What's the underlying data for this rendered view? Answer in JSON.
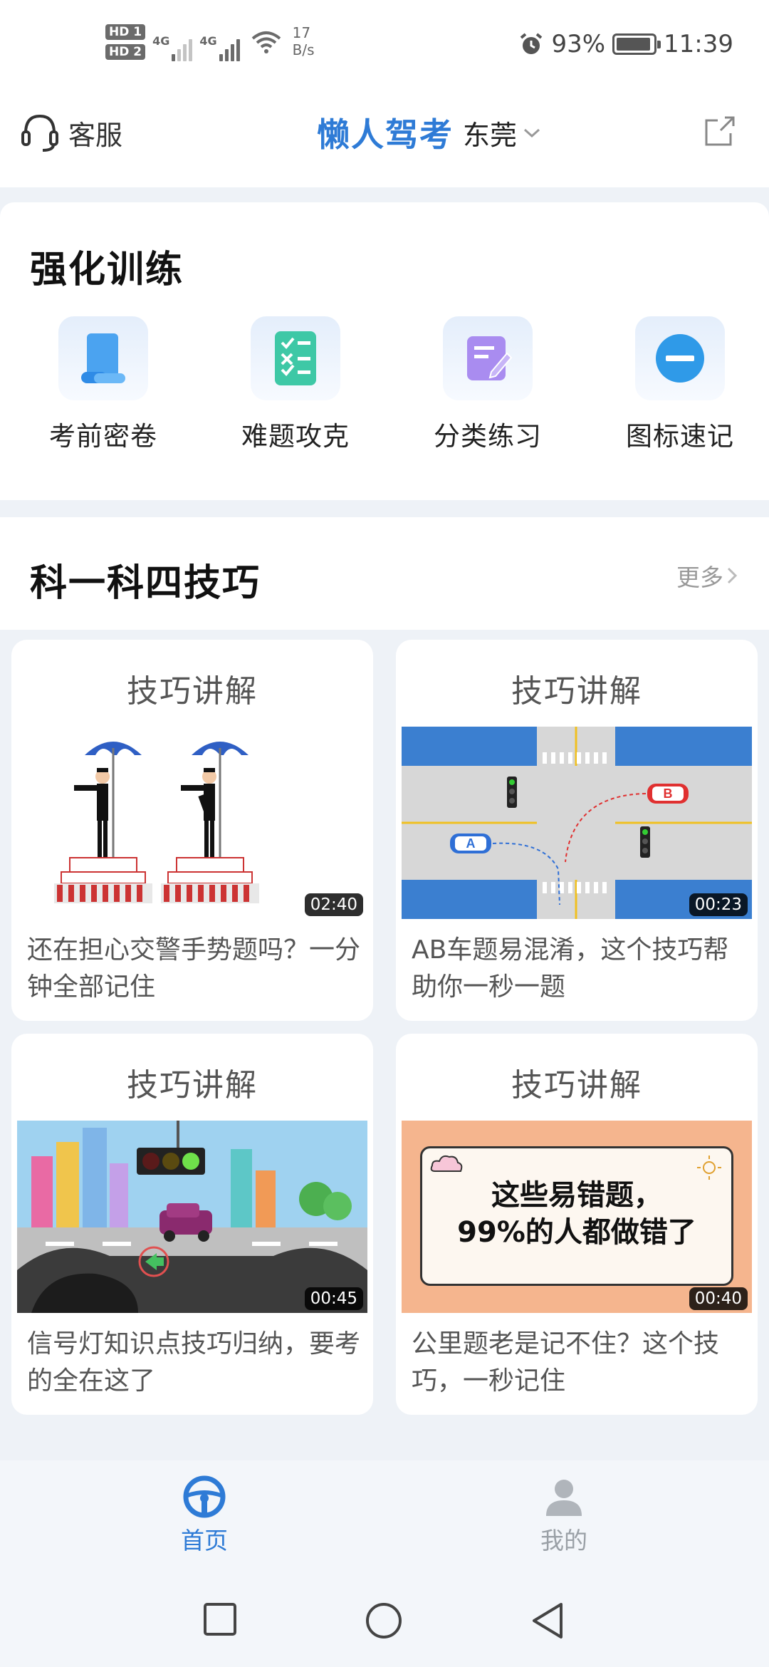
{
  "status_bar": {
    "hd1": "HD 1",
    "hd2": "HD 2",
    "sim1_label": "4G",
    "sim2_label": "4G",
    "net_speed_value": "17",
    "net_speed_unit": "B/s",
    "battery_percent": "93%",
    "battery_level": 0.93,
    "time": "11:39"
  },
  "header": {
    "service_label": "客服",
    "app_title": "懒人驾考",
    "city": "东莞"
  },
  "training": {
    "title": "强化训练",
    "items": [
      {
        "label": "考前密卷",
        "icon": "scroll-icon"
      },
      {
        "label": "难题攻克",
        "icon": "checklist-icon"
      },
      {
        "label": "分类练习",
        "icon": "edit-note-icon"
      },
      {
        "label": "图标速记",
        "icon": "no-entry-sign-icon"
      }
    ]
  },
  "tips": {
    "title": "科一科四技巧",
    "more_label": "更多",
    "videos": [
      {
        "tag": "技巧讲解",
        "duration": "02:40",
        "desc": "还在担心交警手势题吗？一分钟全部记住",
        "thumb": "traffic-police-gesture"
      },
      {
        "tag": "技巧讲解",
        "duration": "00:23",
        "desc": "AB车题易混淆，这个技巧帮助你一秒一题",
        "thumb": "intersection-ab-cars"
      },
      {
        "tag": "技巧讲解",
        "duration": "00:45",
        "desc": "信号灯知识点技巧归纳，要考的全在这了",
        "thumb": "traffic-light-dashboard"
      },
      {
        "tag": "技巧讲解",
        "duration": "00:40",
        "desc": "公里题老是记不住？这个技巧，一秒记住",
        "thumb": "mistake-poster"
      }
    ],
    "poster_line1": "这些易错题，",
    "poster_line2": "99%的人都做错了",
    "car_a": "A",
    "car_b": "B"
  },
  "bottom_nav": {
    "home_label": "首页",
    "mine_label": "我的"
  },
  "colors": {
    "brand_blue": "#2e7bd6",
    "inactive_gray": "#9aa0a6"
  }
}
